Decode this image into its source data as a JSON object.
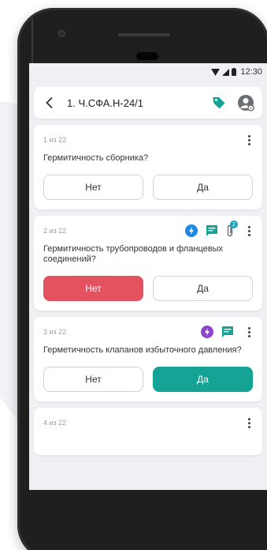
{
  "status_bar": {
    "time": "12:30"
  },
  "header": {
    "title": "1. Ч.СФА.Н-24/1"
  },
  "cards": [
    {
      "counter": "1 из 22",
      "question": "Гермитичность сборника?",
      "no_label": "Нет",
      "yes_label": "Да",
      "selected": "none"
    },
    {
      "counter": "2 из 22",
      "question": "Гермитичность трубопроводов и фланцевых соединений?",
      "no_label": "Нет",
      "yes_label": "Да",
      "selected": "no",
      "attachment_count": "2"
    },
    {
      "counter": "3 из 22",
      "question": "Герметичность клапанов избыточного давления?",
      "no_label": "Нет",
      "yes_label": "Да",
      "selected": "yes"
    },
    {
      "counter": "4 из 22"
    }
  ],
  "colors": {
    "accent": "#14a395",
    "danger": "#e4515f",
    "lightning_blue": "#1e88e5",
    "lightning_purple": "#8e44c8",
    "comment_green": "#14a395"
  },
  "icons": {
    "back": "chevron-left-icon",
    "tag": "tag-icon",
    "user": "user-settings-icon",
    "more": "more-vertical-icon",
    "lightning": "lightning-icon",
    "comment": "comment-icon",
    "attachment": "paperclip-icon"
  }
}
